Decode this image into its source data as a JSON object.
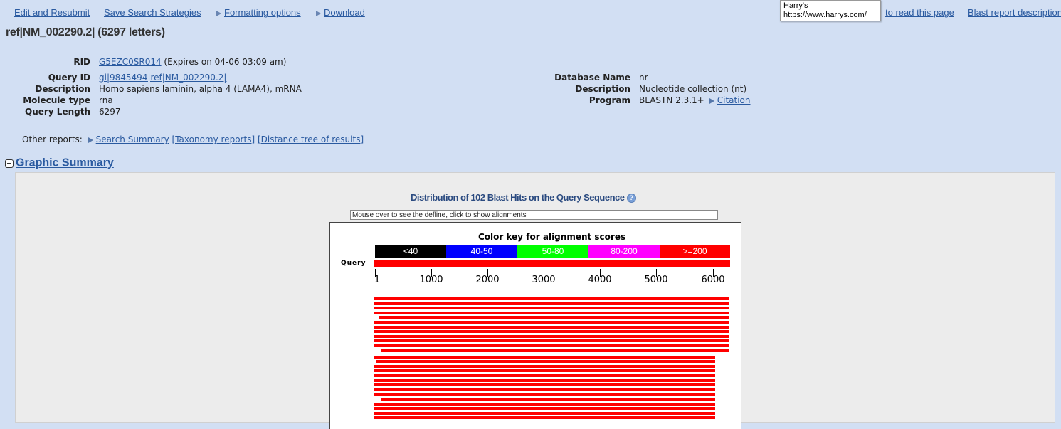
{
  "nav": {
    "edit": "Edit and Resubmit",
    "save": "Save Search Strategies",
    "formatting": "Formatting options",
    "download": "Download",
    "how_to_read": "to read this page",
    "blast_desc": "Blast report description"
  },
  "tooltip": {
    "line1": "Harry's",
    "line2": "https://www.harrys.com/"
  },
  "title": "ref|NM_002290.2| (6297 letters)",
  "left_info": [
    {
      "label": "RID",
      "value": "G5EZC0SR014",
      "extra": " (Expires on 04-06 03:09 am)",
      "link": true
    },
    {
      "label": "Query ID",
      "value": "gi|9845494|ref|NM_002290.2|",
      "extra": "",
      "link": true
    },
    {
      "label": "Description",
      "value": "Homo sapiens laminin, alpha 4 (LAMA4), mRNA",
      "extra": "",
      "link": false
    },
    {
      "label": "Molecule type",
      "value": "rna",
      "extra": "",
      "link": false
    },
    {
      "label": "Query Length",
      "value": "6297",
      "extra": "",
      "link": false
    }
  ],
  "right_info": [
    {
      "label": "Database Name",
      "value": "nr"
    },
    {
      "label": "Description",
      "value": "Nucleotide collection (nt)"
    },
    {
      "label": "Program",
      "value": "BLASTN 2.3.1+",
      "citation": "Citation"
    }
  ],
  "other_reports": {
    "label": "Other reports:",
    "search_summary": "Search Summary",
    "taxonomy": "[Taxonomy reports]",
    "distance": "[Distance tree of results]"
  },
  "graphic_summary": "Graphic Summary",
  "distribution_title": "Distribution of 102 Blast Hits on the Query Sequence",
  "mouse_hint": "Mouse over to see the defline, click to show alignments",
  "color_key": {
    "title": "Color key for alignment scores",
    "items": [
      {
        "label": "<40",
        "color": "#000000"
      },
      {
        "label": "40-50",
        "color": "#0000ff"
      },
      {
        "label": "50-80",
        "color": "#00ff00"
      },
      {
        "label": "80-200",
        "color": "#ff00ff"
      },
      {
        "label": ">=200",
        "color": "#ff0000"
      }
    ]
  },
  "query_label": "Query",
  "scale": {
    "max": 6297,
    "ticks": [
      1,
      1000,
      2000,
      3000,
      4000,
      5000,
      6000
    ]
  },
  "hits": [
    [
      1,
      6297
    ],
    [
      1,
      6297
    ],
    [
      1,
      6297
    ],
    [
      1,
      6297
    ],
    [
      80,
      6297
    ],
    [
      1,
      6297
    ],
    [
      1,
      6297
    ],
    [
      1,
      6297
    ],
    [
      1,
      6297
    ],
    [
      1,
      6297
    ],
    [
      1,
      6297
    ],
    [
      120,
      6297
    ],
    [
      1,
      6050
    ],
    [
      40,
      6050
    ],
    [
      1,
      6050
    ],
    [
      1,
      6050
    ],
    [
      1,
      6050
    ],
    [
      1,
      6050
    ],
    [
      1,
      6050
    ],
    [
      1,
      6050
    ],
    [
      1,
      6050
    ],
    [
      120,
      6050
    ],
    [
      1,
      6050
    ],
    [
      1,
      6050
    ],
    [
      1,
      6050
    ],
    [
      1,
      6050
    ]
  ]
}
